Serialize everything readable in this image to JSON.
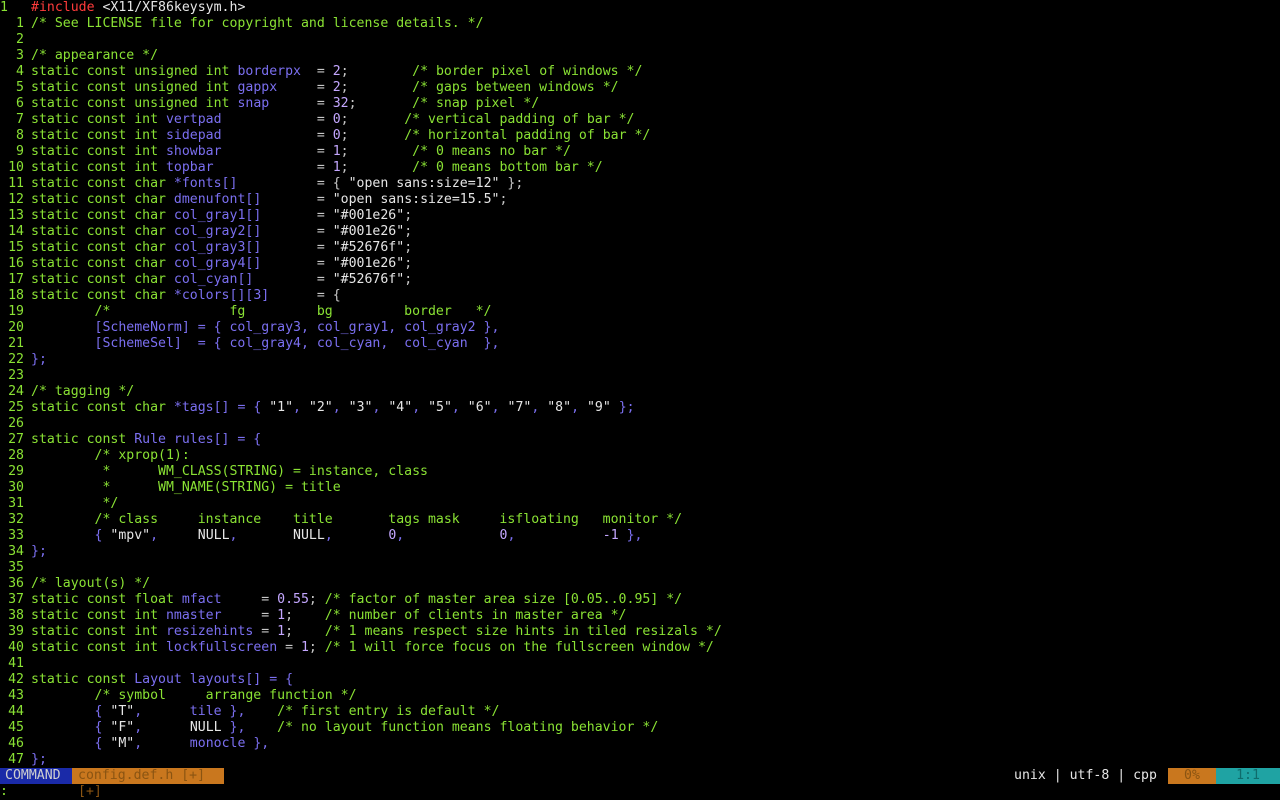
{
  "editor": {
    "lines": [
      {
        "n": "1",
        "cur": true,
        "segs": [
          [
            "pre",
            "#include "
          ],
          [
            "ph",
            "<X11/XF86keysym.h>"
          ]
        ]
      },
      {
        "n": "1",
        "segs": [
          [
            "cmt",
            "/* See LICENSE file for copyright and license details. */"
          ]
        ]
      },
      {
        "n": "2",
        "segs": []
      },
      {
        "n": "3",
        "segs": [
          [
            "cmt",
            "/* appearance */"
          ]
        ]
      },
      {
        "n": "4",
        "segs": [
          [
            "kw",
            "static const unsigned int "
          ],
          [
            "id",
            "borderpx"
          ],
          [
            "plain",
            "  = "
          ],
          [
            "num",
            "2"
          ],
          [
            "plain",
            ";        "
          ],
          [
            "cmt",
            "/* border pixel of windows */"
          ]
        ]
      },
      {
        "n": "5",
        "segs": [
          [
            "kw",
            "static const unsigned int "
          ],
          [
            "id",
            "gappx"
          ],
          [
            "plain",
            "     = "
          ],
          [
            "num",
            "2"
          ],
          [
            "plain",
            ";        "
          ],
          [
            "cmt",
            "/* gaps between windows */"
          ]
        ]
      },
      {
        "n": "6",
        "segs": [
          [
            "kw",
            "static const unsigned int "
          ],
          [
            "id",
            "snap"
          ],
          [
            "plain",
            "      = "
          ],
          [
            "num",
            "32"
          ],
          [
            "plain",
            ";       "
          ],
          [
            "cmt",
            "/* snap pixel */"
          ]
        ]
      },
      {
        "n": "7",
        "segs": [
          [
            "kw",
            "static const int "
          ],
          [
            "id",
            "vertpad"
          ],
          [
            "plain",
            "            = "
          ],
          [
            "num",
            "0"
          ],
          [
            "plain",
            ";       "
          ],
          [
            "cmt",
            "/* vertical padding of bar */"
          ]
        ]
      },
      {
        "n": "8",
        "segs": [
          [
            "kw",
            "static const int "
          ],
          [
            "id",
            "sidepad"
          ],
          [
            "plain",
            "            = "
          ],
          [
            "num",
            "0"
          ],
          [
            "plain",
            ";       "
          ],
          [
            "cmt",
            "/* horizontal padding of bar */"
          ]
        ]
      },
      {
        "n": "9",
        "segs": [
          [
            "kw",
            "static const int "
          ],
          [
            "id",
            "showbar"
          ],
          [
            "plain",
            "            = "
          ],
          [
            "num",
            "1"
          ],
          [
            "plain",
            ";        "
          ],
          [
            "cmt",
            "/* 0 means no bar */"
          ]
        ]
      },
      {
        "n": "10",
        "segs": [
          [
            "kw",
            "static const int "
          ],
          [
            "id",
            "topbar"
          ],
          [
            "plain",
            "             = "
          ],
          [
            "num",
            "1"
          ],
          [
            "plain",
            ";        "
          ],
          [
            "cmt",
            "/* 0 means bottom bar */"
          ]
        ]
      },
      {
        "n": "11",
        "segs": [
          [
            "kw",
            "static const char "
          ],
          [
            "id",
            "*fonts[]"
          ],
          [
            "plain",
            "          = { "
          ],
          [
            "str",
            "\"open sans:size=12\""
          ],
          [
            "plain",
            " };"
          ]
        ]
      },
      {
        "n": "12",
        "segs": [
          [
            "kw",
            "static const char "
          ],
          [
            "id",
            "dmenufont[]"
          ],
          [
            "plain",
            "       = "
          ],
          [
            "str",
            "\"open sans:size=15.5\""
          ],
          [
            "plain",
            ";"
          ]
        ]
      },
      {
        "n": "13",
        "segs": [
          [
            "kw",
            "static const char "
          ],
          [
            "id",
            "col_gray1[]"
          ],
          [
            "plain",
            "       = "
          ],
          [
            "str",
            "\"#001e26\""
          ],
          [
            "plain",
            ";"
          ]
        ]
      },
      {
        "n": "14",
        "segs": [
          [
            "kw",
            "static const char "
          ],
          [
            "id",
            "col_gray2[]"
          ],
          [
            "plain",
            "       = "
          ],
          [
            "str",
            "\"#001e26\""
          ],
          [
            "plain",
            ";"
          ]
        ]
      },
      {
        "n": "15",
        "segs": [
          [
            "kw",
            "static const char "
          ],
          [
            "id",
            "col_gray3[]"
          ],
          [
            "plain",
            "       = "
          ],
          [
            "str",
            "\"#52676f\""
          ],
          [
            "plain",
            ";"
          ]
        ]
      },
      {
        "n": "16",
        "segs": [
          [
            "kw",
            "static const char "
          ],
          [
            "id",
            "col_gray4[]"
          ],
          [
            "plain",
            "       = "
          ],
          [
            "str",
            "\"#001e26\""
          ],
          [
            "plain",
            ";"
          ]
        ]
      },
      {
        "n": "17",
        "segs": [
          [
            "kw",
            "static const char "
          ],
          [
            "id",
            "col_cyan[]"
          ],
          [
            "plain",
            "        = "
          ],
          [
            "str",
            "\"#52676f\""
          ],
          [
            "plain",
            ";"
          ]
        ]
      },
      {
        "n": "18",
        "segs": [
          [
            "kw",
            "static const char "
          ],
          [
            "id",
            "*colors[][3]"
          ],
          [
            "plain",
            "      = {"
          ]
        ]
      },
      {
        "n": "19",
        "segs": [
          [
            "cmt",
            "        /*               fg         bg         border   */"
          ]
        ]
      },
      {
        "n": "20",
        "segs": [
          [
            "id",
            "        [SchemeNorm] = { col_gray3, col_gray1, col_gray2 },"
          ]
        ]
      },
      {
        "n": "21",
        "segs": [
          [
            "id",
            "        [SchemeSel]  = { col_gray4, col_cyan,  col_cyan  },"
          ]
        ]
      },
      {
        "n": "22",
        "segs": [
          [
            "id",
            "};"
          ]
        ]
      },
      {
        "n": "23",
        "segs": []
      },
      {
        "n": "24",
        "segs": [
          [
            "cmt",
            "/* tagging */"
          ]
        ]
      },
      {
        "n": "25",
        "segs": [
          [
            "kw",
            "static const char "
          ],
          [
            "id",
            "*tags[] = { "
          ],
          [
            "str",
            "\"1\""
          ],
          [
            "id",
            ", "
          ],
          [
            "str",
            "\"2\""
          ],
          [
            "id",
            ", "
          ],
          [
            "str",
            "\"3\""
          ],
          [
            "id",
            ", "
          ],
          [
            "str",
            "\"4\""
          ],
          [
            "id",
            ", "
          ],
          [
            "str",
            "\"5\""
          ],
          [
            "id",
            ", "
          ],
          [
            "str",
            "\"6\""
          ],
          [
            "id",
            ", "
          ],
          [
            "str",
            "\"7\""
          ],
          [
            "id",
            ", "
          ],
          [
            "str",
            "\"8\""
          ],
          [
            "id",
            ", "
          ],
          [
            "str",
            "\"9\""
          ],
          [
            "id",
            " };"
          ]
        ]
      },
      {
        "n": "26",
        "segs": []
      },
      {
        "n": "27",
        "segs": [
          [
            "kw",
            "static const "
          ],
          [
            "id",
            "Rule rules[] = {"
          ]
        ]
      },
      {
        "n": "28",
        "segs": [
          [
            "cmt",
            "        /* xprop(1):"
          ]
        ]
      },
      {
        "n": "29",
        "segs": [
          [
            "cmt",
            "         *      WM_CLASS(STRING) = instance, class"
          ]
        ]
      },
      {
        "n": "30",
        "segs": [
          [
            "cmt",
            "         *      WM_NAME(STRING) = title"
          ]
        ]
      },
      {
        "n": "31",
        "segs": [
          [
            "cmt",
            "         */"
          ]
        ]
      },
      {
        "n": "32",
        "segs": [
          [
            "cmt",
            "        /* class     instance    title       tags mask     isfloating   monitor */"
          ]
        ]
      },
      {
        "n": "33",
        "segs": [
          [
            "id",
            "        { "
          ],
          [
            "str",
            "\"mpv\""
          ],
          [
            "id",
            ",     "
          ],
          [
            "str",
            "NULL"
          ],
          [
            "id",
            ",       "
          ],
          [
            "str",
            "NULL"
          ],
          [
            "id",
            ",       "
          ],
          [
            "num",
            "0"
          ],
          [
            "id",
            ",            "
          ],
          [
            "num",
            "0"
          ],
          [
            "id",
            ",           "
          ],
          [
            "num",
            "-1"
          ],
          [
            "id",
            " },"
          ]
        ]
      },
      {
        "n": "34",
        "segs": [
          [
            "id",
            "};"
          ]
        ]
      },
      {
        "n": "35",
        "segs": []
      },
      {
        "n": "36",
        "segs": [
          [
            "cmt",
            "/* layout(s) */"
          ]
        ]
      },
      {
        "n": "37",
        "segs": [
          [
            "kw",
            "static const float "
          ],
          [
            "id",
            "mfact"
          ],
          [
            "plain",
            "     = "
          ],
          [
            "num",
            "0.55"
          ],
          [
            "plain",
            "; "
          ],
          [
            "cmt",
            "/* factor of master area size [0.05..0.95] */"
          ]
        ]
      },
      {
        "n": "38",
        "segs": [
          [
            "kw",
            "static const int "
          ],
          [
            "id",
            "nmaster"
          ],
          [
            "plain",
            "     = "
          ],
          [
            "num",
            "1"
          ],
          [
            "plain",
            ";    "
          ],
          [
            "cmt",
            "/* number of clients in master area */"
          ]
        ]
      },
      {
        "n": "39",
        "segs": [
          [
            "kw",
            "static const int "
          ],
          [
            "id",
            "resizehints"
          ],
          [
            "plain",
            " = "
          ],
          [
            "num",
            "1"
          ],
          [
            "plain",
            ";    "
          ],
          [
            "cmt",
            "/* 1 means respect size hints in tiled resizals */"
          ]
        ]
      },
      {
        "n": "40",
        "segs": [
          [
            "kw",
            "static const int "
          ],
          [
            "id",
            "lockfullscreen"
          ],
          [
            "plain",
            " = "
          ],
          [
            "num",
            "1"
          ],
          [
            "plain",
            "; "
          ],
          [
            "cmt",
            "/* 1 will force focus on the fullscreen window */"
          ]
        ]
      },
      {
        "n": "41",
        "segs": []
      },
      {
        "n": "42",
        "segs": [
          [
            "kw",
            "static const "
          ],
          [
            "id",
            "Layout layouts[] = {"
          ]
        ]
      },
      {
        "n": "43",
        "segs": [
          [
            "cmt",
            "        /* symbol     arrange function */"
          ]
        ]
      },
      {
        "n": "44",
        "segs": [
          [
            "id",
            "        { "
          ],
          [
            "str",
            "\"T\""
          ],
          [
            "id",
            ",      tile },    "
          ],
          [
            "cmt",
            "/* first entry is default */"
          ]
        ]
      },
      {
        "n": "45",
        "segs": [
          [
            "id",
            "        { "
          ],
          [
            "str",
            "\"F\""
          ],
          [
            "id",
            ",      "
          ],
          [
            "str",
            "NULL"
          ],
          [
            "id",
            " },    "
          ],
          [
            "cmt",
            "/* no layout function means floating behavior */"
          ]
        ]
      },
      {
        "n": "46",
        "segs": [
          [
            "id",
            "        { "
          ],
          [
            "str",
            "\"M\""
          ],
          [
            "id",
            ",      monocle },"
          ]
        ]
      },
      {
        "n": "47",
        "segs": [
          [
            "id",
            "};"
          ]
        ]
      }
    ]
  },
  "statusbar": {
    "mode": "COMMAND",
    "filename": "config.def.h [+] [+]",
    "fileinfo": "unix | utf-8 | cpp",
    "percent": "0%",
    "position": "1:1"
  },
  "cmdline": {
    "text": ":"
  },
  "colors": {
    "keyword": "#8ae234",
    "identifier": "#7b6ff0",
    "number": "#c4a7ff",
    "preproc": "#ff3b3b",
    "mode_bg": "#1a2aa8",
    "file_bg": "#c9771e",
    "pos_bg": "#1fa3a3"
  }
}
